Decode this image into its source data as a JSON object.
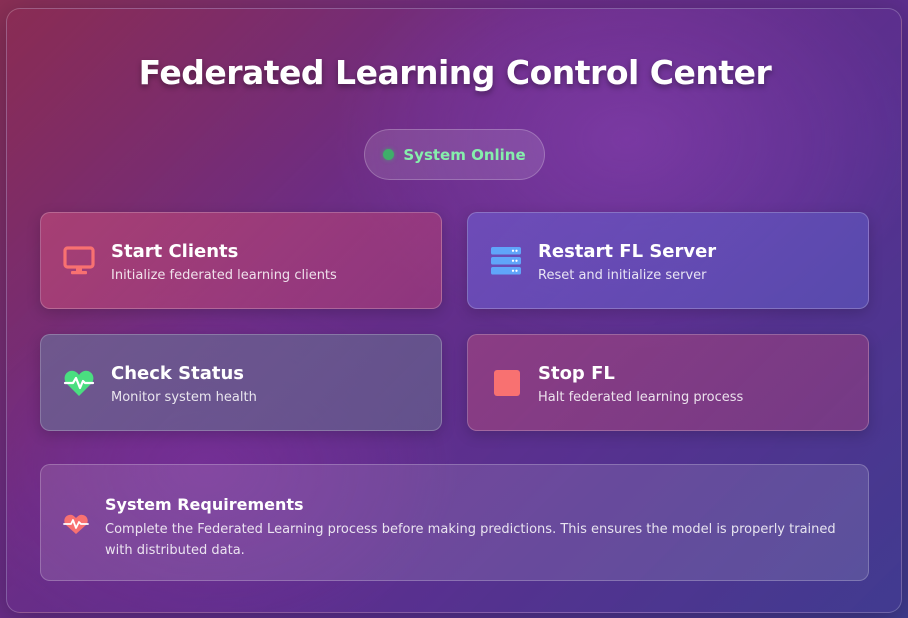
{
  "header": {
    "title": "Federated Learning Control Center"
  },
  "status": {
    "label": "System Online",
    "color": "#3fae6a",
    "text_color": "#86efac"
  },
  "actions": [
    {
      "id": "start-clients",
      "title": "Start Clients",
      "description": "Initialize federated learning clients",
      "icon": "monitor-icon",
      "icon_color": "#f87171"
    },
    {
      "id": "restart-server",
      "title": "Restart FL Server",
      "description": "Reset and initialize server",
      "icon": "server-icon",
      "icon_color": "#60a5fa"
    },
    {
      "id": "check-status",
      "title": "Check Status",
      "description": "Monitor system health",
      "icon": "heartbeat-icon",
      "icon_color": "#4ade80"
    },
    {
      "id": "stop-fl",
      "title": "Stop FL",
      "description": "Halt federated learning process",
      "icon": "stop-icon",
      "icon_color": "#f87171"
    }
  ],
  "requirements": {
    "title": "System Requirements",
    "text": "Complete the Federated Learning process before making predictions. This ensures the model is properly trained with distributed data.",
    "icon": "heart-pulse-icon",
    "icon_color": "#f87171"
  }
}
